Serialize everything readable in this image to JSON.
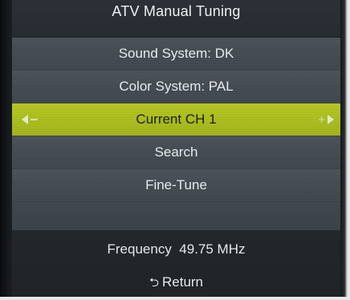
{
  "title": "ATV Manual Tuning",
  "menu": {
    "items": [
      {
        "label": "Sound System: DK"
      },
      {
        "label": "Color System: PAL"
      },
      {
        "label": "Current CH 1",
        "selected": true
      },
      {
        "label": "Search"
      },
      {
        "label": "Fine-Tune"
      },
      {
        "label": ""
      }
    ]
  },
  "footer": {
    "frequency_label": "Frequency",
    "frequency_value": "49.75 MHz",
    "return_label": "Return"
  },
  "colors": {
    "highlight": "#a8bb1c",
    "menu_bg": "#444a51",
    "title_bg": "#2b3137"
  },
  "icons": {
    "left_arrow": "triangle-left-icon",
    "right_arrow": "triangle-right-icon",
    "minus": "minus-icon",
    "plus": "plus-icon",
    "return": "return-arrow-icon"
  }
}
